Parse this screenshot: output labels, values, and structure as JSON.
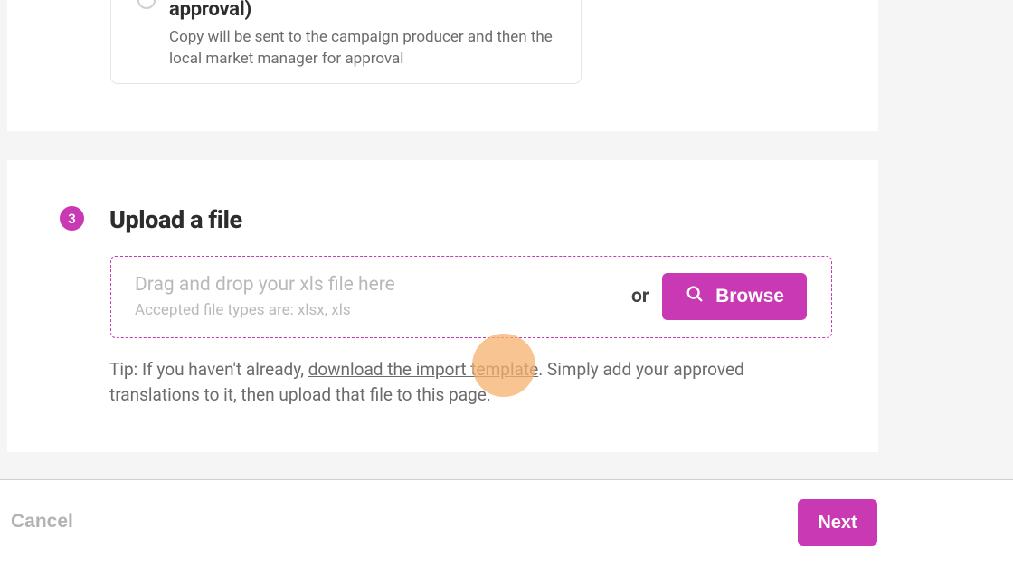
{
  "option": {
    "title_visible": "approval)",
    "description": "Copy will be sent to the campaign producer and then the local market manager for approval"
  },
  "step": {
    "number": "3",
    "heading": "Upload a file"
  },
  "dropzone": {
    "main": "Drag and drop your xls file here",
    "sub": "Accepted file types are: xlsx, xls",
    "or": "or",
    "browse": "Browse"
  },
  "tip": {
    "prefix": "Tip: If you haven't already, ",
    "link": "download the import template",
    "suffix": ". Simply add your approved translations to it, then upload that file to this page."
  },
  "footer": {
    "cancel": "Cancel",
    "next": "Next"
  }
}
